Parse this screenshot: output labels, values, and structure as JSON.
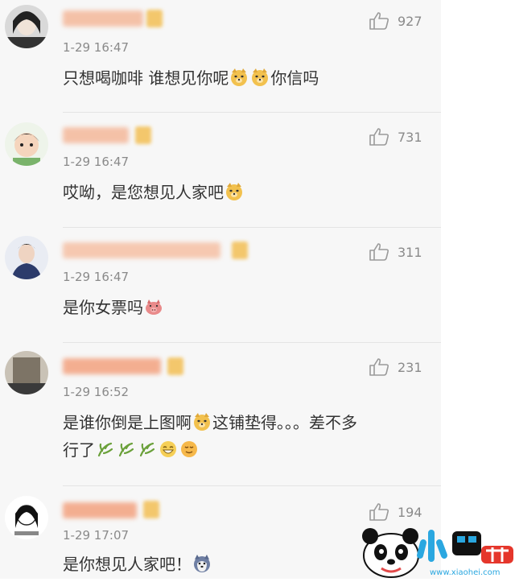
{
  "comments": [
    {
      "time": "1-29 16:47",
      "likes": "927",
      "text_parts": [
        "只想喝咖啡 谁想见你呢",
        "你信吗"
      ]
    },
    {
      "time": "1-29 16:47",
      "likes": "731",
      "text_parts": [
        "哎呦，是您想见人家吧"
      ]
    },
    {
      "time": "1-29 16:47",
      "likes": "311",
      "text_parts": [
        "是你女票吗"
      ]
    },
    {
      "time": "1-29 16:52",
      "likes": "231",
      "text_parts": [
        "是谁你倒是上图啊",
        "这铺垫得。。。差不多",
        "行了"
      ]
    },
    {
      "time": "1-29 17:07",
      "likes": "194",
      "text_parts": [
        "是你想见人家吧！"
      ]
    }
  ],
  "watermark": {
    "domain": "www.xiaohei.com"
  },
  "icons": [
    "thumbs-up-icon",
    "doge-emoji-icon",
    "grass-emoji-icon",
    "laugh-emoji-icon",
    "pig-emoji-icon",
    "husky-emoji-icon"
  ],
  "colors": {
    "feed_bg": "#f7f7f7",
    "text": "#333333",
    "meta": "#8a8a8a",
    "tag": "#f3c25e"
  }
}
